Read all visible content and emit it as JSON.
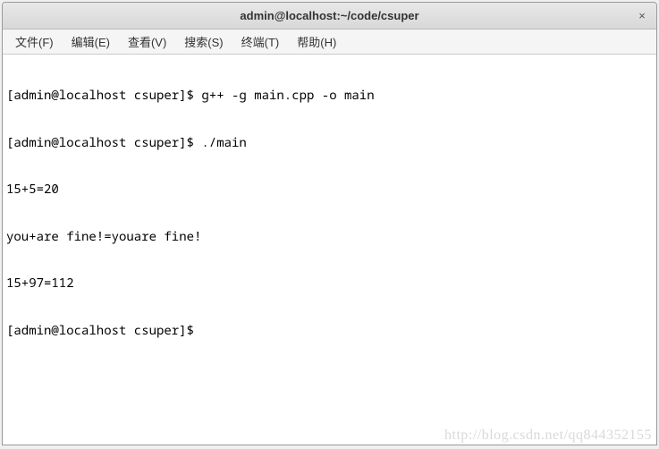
{
  "window": {
    "title": "admin@localhost:~/code/csuper",
    "close_label": "×"
  },
  "menubar": {
    "items": [
      {
        "label": "文件(F)"
      },
      {
        "label": "编辑(E)"
      },
      {
        "label": "查看(V)"
      },
      {
        "label": "搜索(S)"
      },
      {
        "label": "终端(T)"
      },
      {
        "label": "帮助(H)"
      }
    ]
  },
  "terminal": {
    "lines": [
      "[admin@localhost csuper]$ g++ -g main.cpp -o main",
      "[admin@localhost csuper]$ ./main",
      "15+5=20",
      "you+are fine!=youare fine!",
      "15+97=112",
      "[admin@localhost csuper]$ "
    ]
  },
  "watermark": "http://blog.csdn.net/qq844352155"
}
